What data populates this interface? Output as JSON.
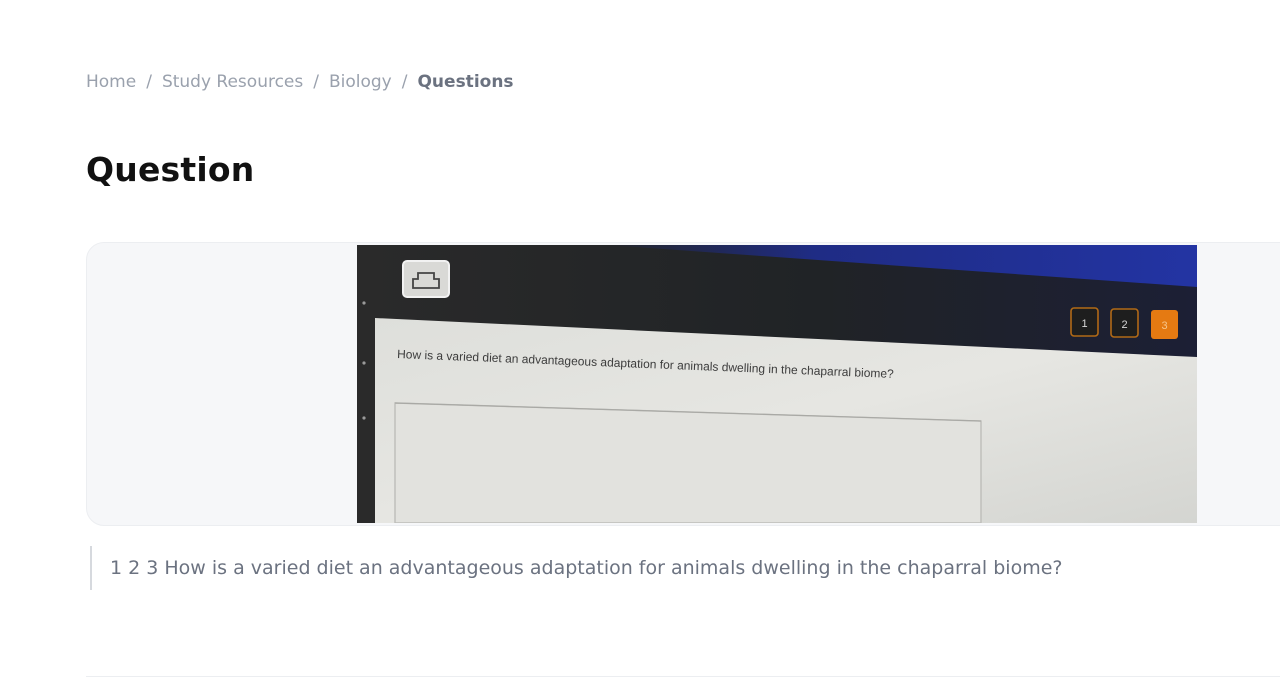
{
  "breadcrumb": {
    "items": [
      {
        "label": "Home"
      },
      {
        "label": "Study Resources"
      },
      {
        "label": "Biology"
      }
    ],
    "separator": "/",
    "current": "Questions"
  },
  "page": {
    "title": "Question"
  },
  "photo": {
    "question_text": "How is a varied diet an advantageous adaptation for animals dwelling in the chaparral biome?",
    "page_buttons": [
      "1",
      "2",
      "3"
    ],
    "active_page": "3",
    "print_icon": "printer-icon"
  },
  "caption": {
    "text": "1 2 3 How is a varied diet an advantageous adaptation for animals dwelling in the chaparral biome?"
  },
  "colors": {
    "text_primary": "#111111",
    "text_muted": "#9aa1ad",
    "card_bg": "#f6f7f9",
    "accent_orange": "#e57a12",
    "screen_blue": "#1f2d8f"
  }
}
